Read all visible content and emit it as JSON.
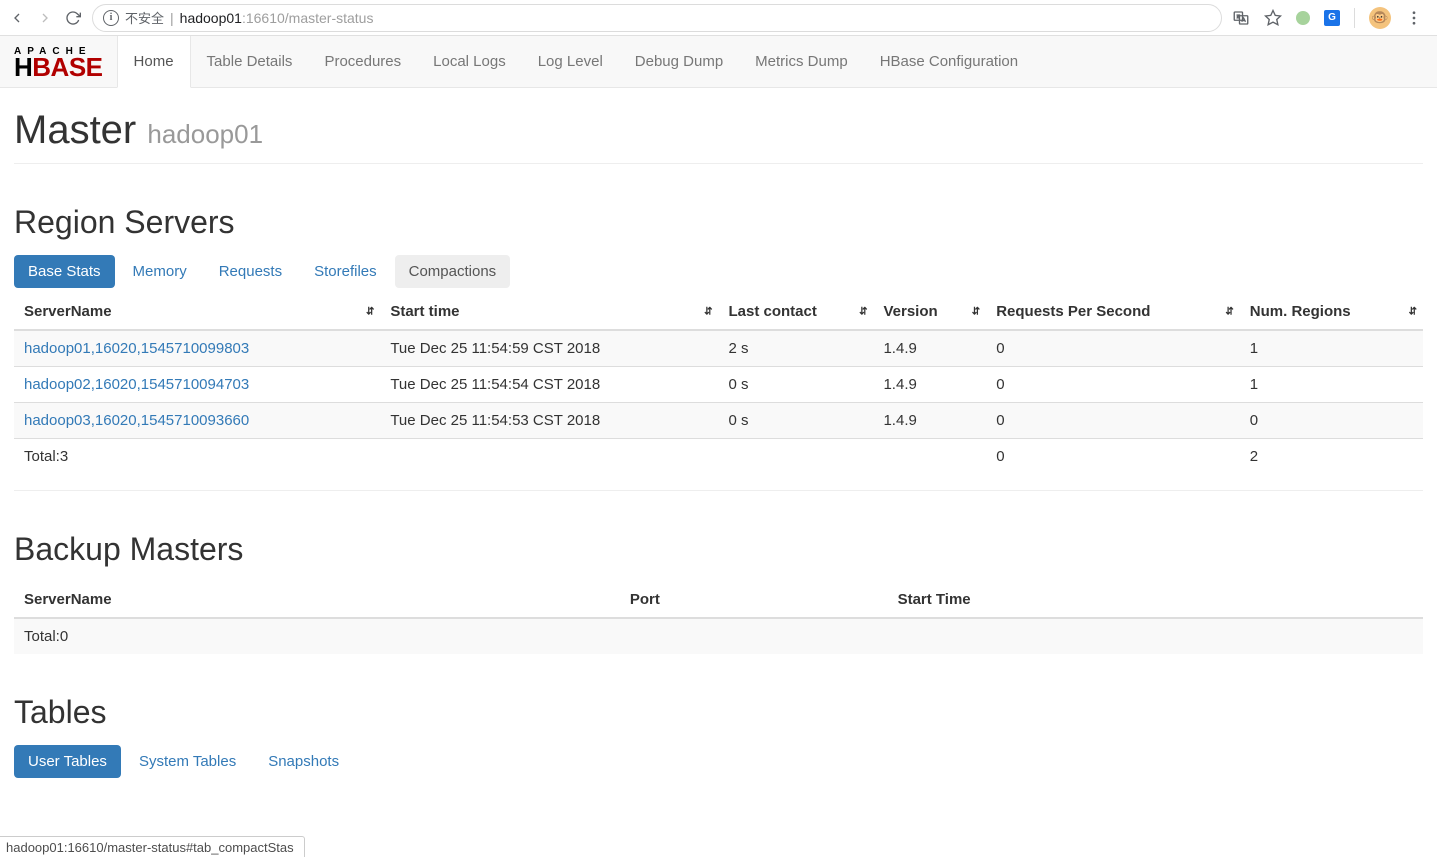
{
  "browser": {
    "not_secure_label": "不安全",
    "url_host": "hadoop01",
    "url_port": ":16610",
    "url_path": "/master-status",
    "translate_label": "⁂",
    "status_bar": "hadoop01:16610/master-status#tab_compactStas"
  },
  "logo": {
    "top": "APACHE",
    "main_black": "H",
    "main_red": "BASE"
  },
  "nav": {
    "items": [
      {
        "label": "Home",
        "active": true
      },
      {
        "label": "Table Details",
        "active": false
      },
      {
        "label": "Procedures",
        "active": false
      },
      {
        "label": "Local Logs",
        "active": false
      },
      {
        "label": "Log Level",
        "active": false
      },
      {
        "label": "Debug Dump",
        "active": false
      },
      {
        "label": "Metrics Dump",
        "active": false
      },
      {
        "label": "HBase Configuration",
        "active": false
      }
    ]
  },
  "header": {
    "title": "Master",
    "subtitle": "hadoop01"
  },
  "region_servers": {
    "title": "Region Servers",
    "tabs": [
      {
        "label": "Base Stats",
        "state": "active"
      },
      {
        "label": "Memory",
        "state": ""
      },
      {
        "label": "Requests",
        "state": ""
      },
      {
        "label": "Storefiles",
        "state": ""
      },
      {
        "label": "Compactions",
        "state": "hover"
      }
    ],
    "columns": [
      "ServerName",
      "Start time",
      "Last contact",
      "Version",
      "Requests Per Second",
      "Num. Regions"
    ],
    "rows": [
      {
        "server": "hadoop01,16020,1545710099803",
        "start": "Tue Dec 25 11:54:59 CST 2018",
        "last": "2 s",
        "version": "1.4.9",
        "rps": "0",
        "regions": "1"
      },
      {
        "server": "hadoop02,16020,1545710094703",
        "start": "Tue Dec 25 11:54:54 CST 2018",
        "last": "0 s",
        "version": "1.4.9",
        "rps": "0",
        "regions": "1"
      },
      {
        "server": "hadoop03,16020,1545710093660",
        "start": "Tue Dec 25 11:54:53 CST 2018",
        "last": "0 s",
        "version": "1.4.9",
        "rps": "0",
        "regions": "0"
      }
    ],
    "footer": {
      "total_label": "Total:3",
      "rps": "0",
      "regions": "2"
    }
  },
  "backup_masters": {
    "title": "Backup Masters",
    "columns": [
      "ServerName",
      "Port",
      "Start Time"
    ],
    "total_label": "Total:0"
  },
  "tables": {
    "title": "Tables",
    "tabs": [
      {
        "label": "User Tables",
        "state": "active"
      },
      {
        "label": "System Tables",
        "state": ""
      },
      {
        "label": "Snapshots",
        "state": ""
      }
    ]
  }
}
